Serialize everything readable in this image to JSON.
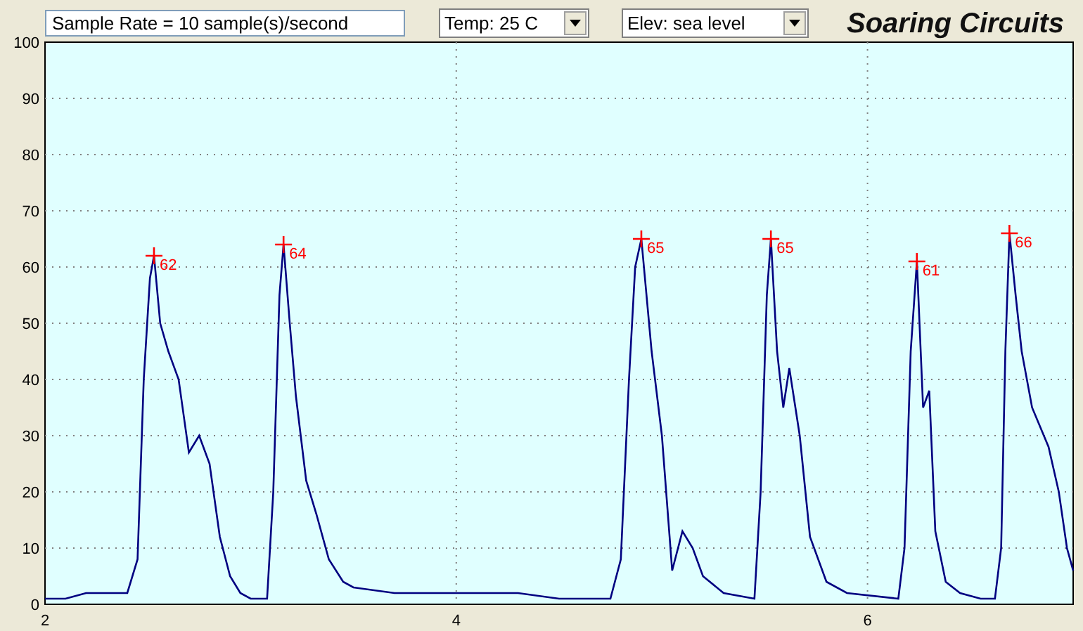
{
  "toolbar": {
    "sample_rate": "Sample Rate =  10 sample(s)/second",
    "temperature": "Temp:  25 C",
    "elevation": "Elev: sea level",
    "logo": "Soaring Circuits"
  },
  "chart": {
    "chart_data": {
      "type": "line",
      "x": [
        2.0,
        2.1,
        2.2,
        2.3,
        2.4,
        2.45,
        2.48,
        2.51,
        2.53,
        2.56,
        2.6,
        2.65,
        2.7,
        2.75,
        2.8,
        2.85,
        2.9,
        2.95,
        3.0,
        3.08,
        3.11,
        3.14,
        3.16,
        3.19,
        3.22,
        3.27,
        3.32,
        3.38,
        3.45,
        3.5,
        3.7,
        3.9,
        4.1,
        4.3,
        4.5,
        4.75,
        4.8,
        4.84,
        4.87,
        4.9,
        4.95,
        5.0,
        5.05,
        5.1,
        5.15,
        5.2,
        5.3,
        5.45,
        5.48,
        5.51,
        5.53,
        5.56,
        5.59,
        5.62,
        5.67,
        5.72,
        5.8,
        5.9,
        6.15,
        6.18,
        6.21,
        6.24,
        6.27,
        6.3,
        6.33,
        6.38,
        6.45,
        6.55,
        6.62,
        6.65,
        6.67,
        6.69,
        6.72,
        6.75,
        6.8,
        6.88,
        6.93,
        6.97,
        7.0
      ],
      "grid": true,
      "series": [
        {
          "color": "#000080",
          "values": [
            1,
            1,
            2,
            2,
            2,
            8,
            40,
            58,
            62,
            50,
            45,
            40,
            27,
            30,
            25,
            12,
            5,
            2,
            1,
            1,
            20,
            55,
            64,
            50,
            37,
            22,
            16,
            8,
            4,
            3,
            2,
            2,
            2,
            2,
            1,
            1,
            8,
            40,
            60,
            65,
            45,
            30,
            6,
            13,
            10,
            5,
            2,
            1,
            20,
            55,
            65,
            45,
            35,
            42,
            30,
            12,
            4,
            2,
            1,
            10,
            45,
            61,
            35,
            38,
            13,
            4,
            2,
            1,
            1,
            10,
            45,
            66,
            55,
            45,
            35,
            28,
            20,
            10,
            6
          ]
        }
      ],
      "xlim": [
        2,
        7
      ],
      "ylim": [
        0,
        100
      ],
      "xticks": [
        2,
        4,
        6
      ],
      "yticks": [
        0,
        10,
        20,
        30,
        40,
        50,
        60,
        70,
        80,
        90,
        100
      ],
      "annotations": [
        {
          "x": 2.53,
          "y": 62,
          "text": "62"
        },
        {
          "x": 3.16,
          "y": 64,
          "text": "64"
        },
        {
          "x": 4.9,
          "y": 65,
          "text": "65"
        },
        {
          "x": 5.53,
          "y": 65,
          "text": "65"
        },
        {
          "x": 6.24,
          "y": 61,
          "text": "61"
        },
        {
          "x": 6.69,
          "y": 66,
          "text": "66"
        }
      ]
    }
  }
}
